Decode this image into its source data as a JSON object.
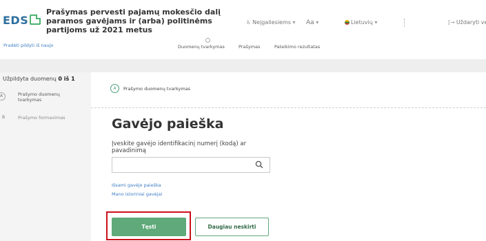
{
  "header": {
    "logo_text": "EDS",
    "title": "Prašymas pervesti pajamų mokesčio dalį paramos gavėjams ir (arba) politinėms partijoms už 2021 metus",
    "accessibility": "Neįgaliesiems",
    "font_size": "Aa",
    "language": "Lietuvių",
    "close": "Uždaryti ve"
  },
  "stepbar": {
    "start_over": "Pradėti pildyti iš naujo",
    "tabs": [
      "Duomenų tvarkymas",
      "Prašymas",
      "Pateikimo rezultatas"
    ]
  },
  "sidebar": {
    "progress_label": "Užpildyta duomenų",
    "progress_value": "0 iš 1",
    "items": [
      {
        "num": "A",
        "label": "Prašymo duomenų tvarkymas"
      },
      {
        "num": "B",
        "label": "Prašymo formavimas"
      }
    ]
  },
  "main": {
    "crumb_num": "A",
    "crumb": "Prašymo duomenų tvarkymas",
    "heading": "Gavėjo paieška",
    "label": "Įveskite gavėjo identifikacinį numerį (kodą) ar pavadinimą",
    "search_value": "",
    "link_detailed": "Išsami gavėjo paieška",
    "link_history": "Mano istoriniai gavėjai",
    "btn_continue": "Tęsti",
    "btn_skip": "Daugiau neskirti"
  },
  "colors": {
    "accent_green": "#5fa97a",
    "link_blue": "#3b7cc4",
    "highlight_red": "#cc0f1b"
  }
}
